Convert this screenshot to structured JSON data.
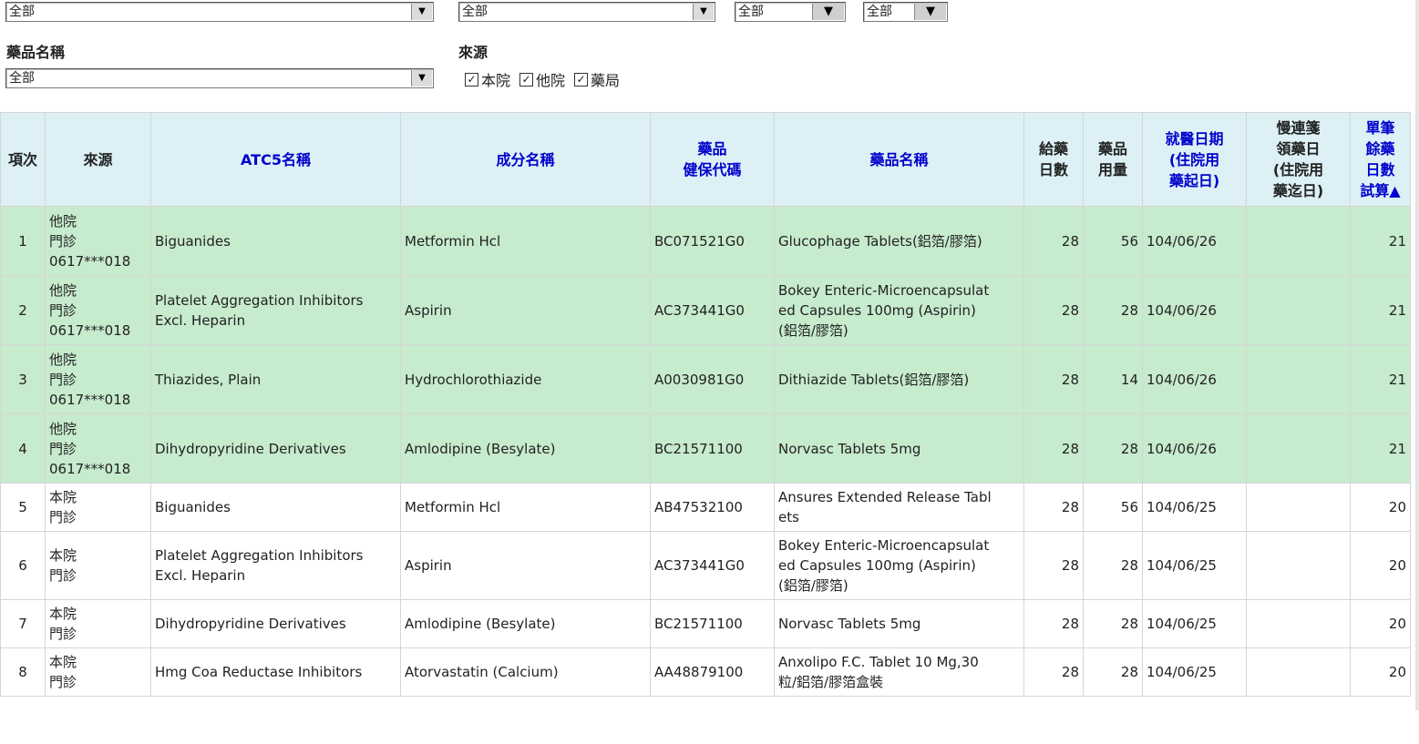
{
  "filters": {
    "top_selects": [
      "全部",
      "全部",
      "全部",
      "全部"
    ],
    "drug_name_label": "藥品名稱",
    "drug_name_value": "全部",
    "source_label": "來源",
    "source_checks": [
      {
        "label": "本院",
        "checked": true
      },
      {
        "label": "他院",
        "checked": true
      },
      {
        "label": "藥局",
        "checked": true
      }
    ]
  },
  "table": {
    "headers": {
      "no": "項次",
      "source": "來源",
      "atc5": "ATC5名稱",
      "ingredient": "成分名稱",
      "code_1": "藥品",
      "code_2": "健保代碼",
      "drug": "藥品名稱",
      "days_1": "給藥",
      "days_2": "日數",
      "qty_1": "藥品",
      "qty_2": "用量",
      "visit_1": "就醫日期",
      "visit_2": "(住院用",
      "visit_3": "藥起日)",
      "refill_1": "慢連箋",
      "refill_2": "領藥日",
      "refill_3": "(住院用",
      "refill_4": "藥迄日)",
      "remain_1": "單筆",
      "remain_2": "餘藥",
      "remain_3": "日數",
      "remain_4": "試算▲"
    },
    "rows": [
      {
        "no": "1",
        "src1": "他院",
        "src2": "門診",
        "src3": "0617***018",
        "atc5": "Biguanides",
        "ingredient": "Metformin Hcl",
        "code": "BC071521G0",
        "drug1": "Glucophage Tablets(鋁箔/膠箔)",
        "drug2": "",
        "drug3": "",
        "days": "28",
        "qty": "56",
        "visit": "104/06/26",
        "refill": "",
        "remain": "21"
      },
      {
        "no": "2",
        "src1": "他院",
        "src2": "門診",
        "src3": "0617***018",
        "atc5": "Platelet Aggregation Inhibitors Excl. Heparin",
        "ingredient": "Aspirin",
        "code": "AC373441G0",
        "drug1": "Bokey Enteric-Microencapsulat",
        "drug2": "ed Capsules 100mg (Aspirin)",
        "drug3": "(鋁箔/膠箔)",
        "days": "28",
        "qty": "28",
        "visit": "104/06/26",
        "refill": "",
        "remain": "21"
      },
      {
        "no": "3",
        "src1": "他院",
        "src2": "門診",
        "src3": "0617***018",
        "atc5": "Thiazides, Plain",
        "ingredient": "Hydrochlorothiazide",
        "code": "A0030981G0",
        "drug1": "Dithiazide Tablets(鋁箔/膠箔)",
        "drug2": "",
        "drug3": "",
        "days": "28",
        "qty": "14",
        "visit": "104/06/26",
        "refill": "",
        "remain": "21"
      },
      {
        "no": "4",
        "src1": "他院",
        "src2": "門診",
        "src3": "0617***018",
        "atc5": "Dihydropyridine Derivatives",
        "ingredient": "Amlodipine (Besylate)",
        "code": "BC21571100",
        "drug1": "Norvasc Tablets 5mg",
        "drug2": "",
        "drug3": "",
        "days": "28",
        "qty": "28",
        "visit": "104/06/26",
        "refill": "",
        "remain": "21"
      },
      {
        "no": "5",
        "src1": "本院",
        "src2": "門診",
        "src3": "",
        "atc5": "Biguanides",
        "ingredient": "Metformin Hcl",
        "code": "AB47532100",
        "drug1": "Ansures Extended Release Tabl",
        "drug2": "ets",
        "drug3": "",
        "days": "28",
        "qty": "56",
        "visit": "104/06/25",
        "refill": "",
        "remain": "20"
      },
      {
        "no": "6",
        "src1": "本院",
        "src2": "門診",
        "src3": "",
        "atc5": "Platelet Aggregation Inhibitors Excl. Heparin",
        "ingredient": "Aspirin",
        "code": "AC373441G0",
        "drug1": "Bokey Enteric-Microencapsulat",
        "drug2": "ed Capsules 100mg (Aspirin)",
        "drug3": "(鋁箔/膠箔)",
        "days": "28",
        "qty": "28",
        "visit": "104/06/25",
        "refill": "",
        "remain": "20"
      },
      {
        "no": "7",
        "src1": "本院",
        "src2": "門診",
        "src3": "",
        "atc5": "Dihydropyridine Derivatives",
        "ingredient": "Amlodipine (Besylate)",
        "code": "BC21571100",
        "drug1": "Norvasc Tablets 5mg",
        "drug2": "",
        "drug3": "",
        "days": "28",
        "qty": "28",
        "visit": "104/06/25",
        "refill": "",
        "remain": "20"
      },
      {
        "no": "8",
        "src1": "本院",
        "src2": "門診",
        "src3": "",
        "atc5": "Hmg Coa Reductase Inhibitors",
        "ingredient": "Atorvastatin (Calcium)",
        "code": "AA48879100",
        "drug1": "Anxolipo F.C. Tablet 10 Mg,30",
        "drug2": "粒/鋁箔/膠箔盒裝",
        "drug3": "",
        "days": "28",
        "qty": "28",
        "visit": "104/06/25",
        "refill": "",
        "remain": "20"
      }
    ]
  }
}
